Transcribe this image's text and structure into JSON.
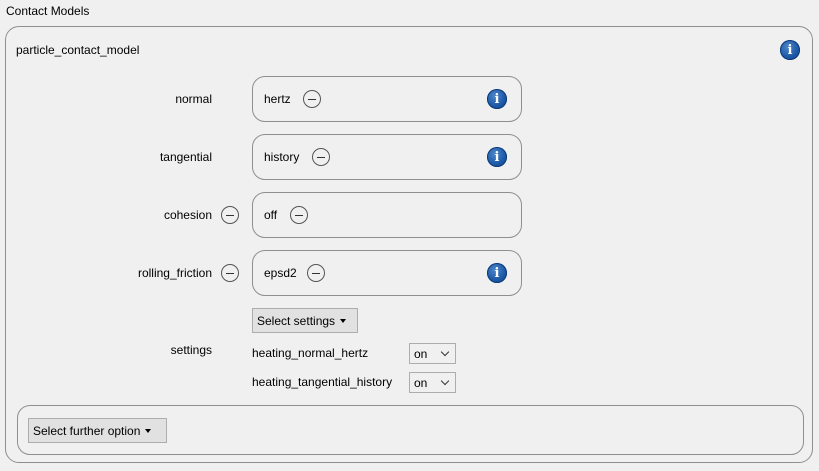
{
  "section": {
    "title": "Contact Models"
  },
  "model": {
    "title": "particle_contact_model",
    "info_icon": "info-icon"
  },
  "rows": [
    {
      "label": "normal",
      "value": "hertz",
      "label_removable": false,
      "has_info": true
    },
    {
      "label": "tangential",
      "value": "history",
      "label_removable": false,
      "has_info": true
    },
    {
      "label": "cohesion",
      "value": "off",
      "label_removable": true,
      "has_info": false
    },
    {
      "label": "rolling_friction",
      "value": "epsd2",
      "label_removable": true,
      "has_info": true
    }
  ],
  "settings": {
    "label": "settings",
    "select_button": "Select settings",
    "items": [
      {
        "name": "heating_normal_hertz",
        "value": "on"
      },
      {
        "name": "heating_tangential_history",
        "value": "on"
      }
    ]
  },
  "further": {
    "button": "Select further option"
  },
  "colors": {
    "info_blue": "#1d5aa8",
    "border": "#8f8f8f",
    "background": "#f0f0f0"
  }
}
